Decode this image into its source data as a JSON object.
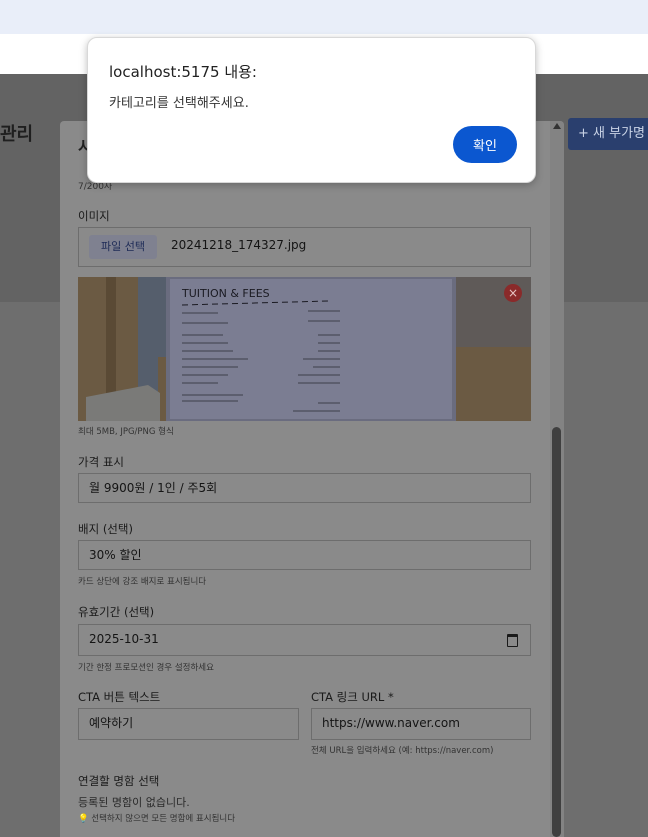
{
  "background_page": {
    "title_partial": "관리",
    "new_button_partial": "+ 새 부가명",
    "modal_header_partial": "시"
  },
  "modal": {
    "char_counter": "7/200자",
    "image_label": "이미지",
    "file_button": "파일 선택",
    "file_name": "20241218_174327.jpg",
    "image_hint": "최대 5MB, JPG/PNG 형식",
    "preview_text": "TUITION & FEES",
    "price_label": "가격 표시",
    "price_value": "월 9900원 / 1인 / 주5회",
    "badge_label": "배지 (선택)",
    "badge_value": "30% 할인",
    "badge_hint": "카드 상단에 강조 배지로 표시됩니다",
    "expiry_label": "유효기간 (선택)",
    "expiry_value": "2025-10-31",
    "expiry_hint": "기간 한정 프로모션인 경우 설정하세요",
    "cta_text_label": "CTA 버튼 텍스트",
    "cta_text_value": "예약하기",
    "cta_url_label": "CTA 링크 URL *",
    "cta_url_value": "https://www.naver.com",
    "cta_url_hint": "전체 URL을 입력하세요 (예: https://naver.com)",
    "clinic_label": "연결할 명함 선택",
    "clinic_empty": "등록된 명함이 없습니다.",
    "clinic_hint": "💡 선택하지 않으면 모든 명함에 표시됩니다"
  },
  "dialog": {
    "title": "localhost:5175 내용:",
    "message": "카테고리를 선택해주세요.",
    "ok_button": "확인"
  },
  "colors": {
    "dialog_button": "#0b57d0",
    "browser_bar": "#e9eef9"
  }
}
